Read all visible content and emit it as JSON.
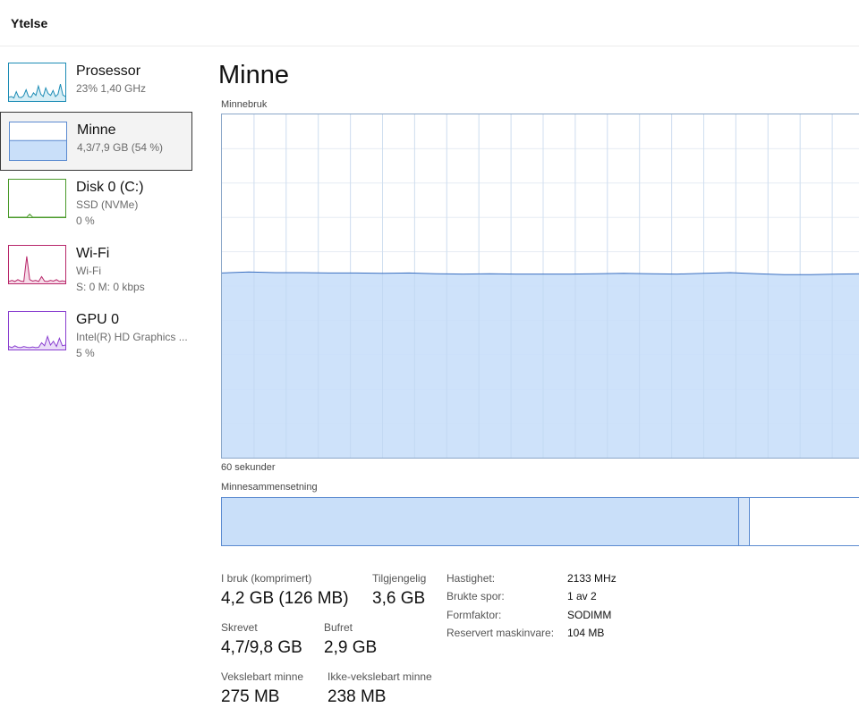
{
  "header": {
    "title": "Ytelse"
  },
  "sidebar": {
    "items": [
      {
        "name": "Prosessor",
        "sub1": "23%  1,40 GHz",
        "sub2": "",
        "color": "#1c8cb5",
        "fill": "#d6eef6",
        "selected": false,
        "thumb": [
          0.1,
          0.12,
          0.08,
          0.25,
          0.1,
          0.09,
          0.14,
          0.3,
          0.12,
          0.1,
          0.22,
          0.15,
          0.4,
          0.18,
          0.12,
          0.35,
          0.2,
          0.15,
          0.28,
          0.12,
          0.18,
          0.45,
          0.16,
          0.12
        ]
      },
      {
        "name": "Minne",
        "sub1": "4,3/7,9 GB (54 %)",
        "sub2": "",
        "color": "#5a8ad0",
        "fill": "#c9dff9",
        "selected": true,
        "thumb": [
          0.52,
          0.52,
          0.52,
          0.52,
          0.52,
          0.52,
          0.52,
          0.52,
          0.52,
          0.52,
          0.52,
          0.52
        ]
      },
      {
        "name": "Disk 0 (C:)",
        "sub1": "SSD (NVMe)",
        "sub2": "0 %",
        "color": "#4a9a2a",
        "fill": "#e3f2dc",
        "selected": false,
        "thumb": [
          0,
          0,
          0,
          0,
          0,
          0,
          0,
          0.08,
          0,
          0,
          0,
          0,
          0,
          0,
          0,
          0,
          0,
          0,
          0,
          0
        ]
      },
      {
        "name": "Wi-Fi",
        "sub1": "Wi-Fi",
        "sub2": "S: 0 M: 0 kbps",
        "color": "#b8276a",
        "fill": "#f6dbe8",
        "selected": false,
        "thumb": [
          0.05,
          0.08,
          0.05,
          0.1,
          0.06,
          0.05,
          0.72,
          0.1,
          0.06,
          0.08,
          0.05,
          0.18,
          0.06,
          0.05,
          0.08,
          0.06,
          0.1,
          0.05,
          0.07,
          0.05
        ]
      },
      {
        "name": "GPU 0",
        "sub1": "Intel(R) HD Graphics ...",
        "sub2": "5 %",
        "color": "#8a3fd0",
        "fill": "#eadcf8",
        "selected": false,
        "thumb": [
          0.08,
          0.05,
          0.1,
          0.06,
          0.05,
          0.08,
          0.06,
          0.05,
          0.07,
          0.05,
          0.06,
          0.18,
          0.1,
          0.35,
          0.12,
          0.22,
          0.08,
          0.3,
          0.1,
          0.12
        ]
      }
    ]
  },
  "main": {
    "title": "Minne",
    "graph_label": "Minnebruk",
    "time_label": "60 sekunder",
    "composition_label": "Minnesammensetning",
    "graph_color": "#3a6fc0",
    "graph_fill": "#c9dff9",
    "usage_series": [
      0.538,
      0.541,
      0.539,
      0.539,
      0.538,
      0.538,
      0.537,
      0.538,
      0.536,
      0.535,
      0.536,
      0.535,
      0.535,
      0.535,
      0.536,
      0.537,
      0.536,
      0.535,
      0.537,
      0.539,
      0.536,
      0.533,
      0.533,
      0.535,
      0.536
    ],
    "composition": {
      "in_use": 0.805,
      "modified": 0.017
    }
  },
  "stats": {
    "in_use_label": "I bruk (komprimert)",
    "in_use_value": "4,2 GB (126 MB)",
    "available_label": "Tilgjengelig",
    "available_value": "3,6 GB",
    "committed_label": "Skrevet",
    "committed_value": "4,7/9,8 GB",
    "cached_label": "Bufret",
    "cached_value": "2,9 GB",
    "paged_label": "Vekslebart minne",
    "paged_value": "275 MB",
    "nonpaged_label": "Ikke-vekslebart minne",
    "nonpaged_value": "238 MB"
  },
  "properties": [
    {
      "label": "Hastighet:",
      "value": "2133 MHz"
    },
    {
      "label": "Brukte spor:",
      "value": "1 av 2"
    },
    {
      "label": "Formfaktor:",
      "value": "SODIMM"
    },
    {
      "label": "Reservert maskinvare:",
      "value": "104 MB"
    }
  ]
}
